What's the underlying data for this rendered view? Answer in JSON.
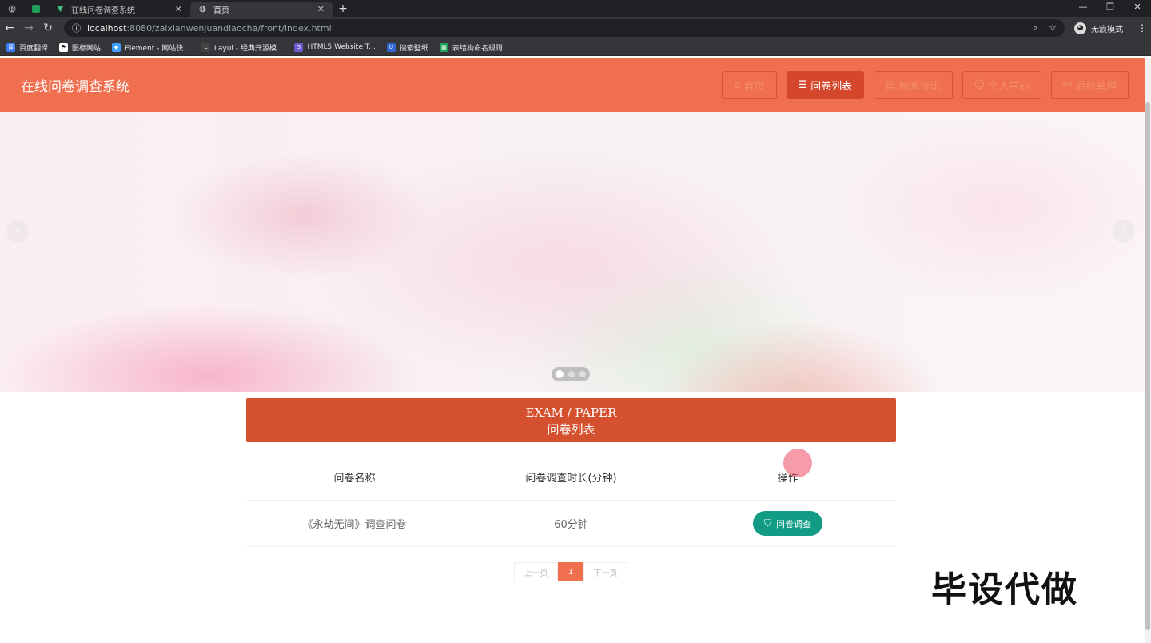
{
  "browser": {
    "tabs": [
      {
        "title": "在线问卷调查系统",
        "active": false
      },
      {
        "title": "首页",
        "active": true
      }
    ],
    "url_host": "localhost",
    "url_path": ":8080/zaixianwenjuandiaocha/front/index.html",
    "incognito_label": "无痕模式",
    "bookmarks": [
      {
        "label": "百度翻译",
        "icon": "translate-icon",
        "color": "#3a7bfd"
      },
      {
        "label": "图标网站",
        "icon": "flag-icon",
        "color": "#222222"
      },
      {
        "label": "Element - 网站快...",
        "icon": "element-icon",
        "color": "#409eff"
      },
      {
        "label": "Layui - 经典开源模...",
        "icon": "layui-icon",
        "color": "#444444"
      },
      {
        "label": "HTML5 Website T...",
        "icon": "html5-icon",
        "color": "#6a5acd"
      },
      {
        "label": "搜索壁纸",
        "icon": "wallpaper-icon",
        "color": "#3367d6"
      },
      {
        "label": "表结构命名规则",
        "icon": "sheet-icon",
        "color": "#1e9e57"
      }
    ]
  },
  "header": {
    "site_title": "在线问卷调查系统",
    "nav": [
      {
        "label": "首页",
        "icon": "home-icon",
        "active": false
      },
      {
        "label": "问卷列表",
        "icon": "list-icon",
        "active": true
      },
      {
        "label": "新闻资讯",
        "icon": "news-icon",
        "active": false
      },
      {
        "label": "个人中心",
        "icon": "user-icon",
        "active": false
      },
      {
        "label": "后台管理",
        "icon": "link-icon",
        "active": false
      }
    ]
  },
  "banner": {
    "prev_icon": "chevron-left-icon",
    "next_icon": "chevron-right-icon",
    "dots": 3,
    "active_dot": 0
  },
  "section": {
    "title_en": "EXAM / PAPER",
    "title_cn": "问卷列表"
  },
  "table": {
    "columns": [
      "问卷名称",
      "问卷调查时长(分钟)",
      "操作"
    ],
    "rows": [
      {
        "name": "《永劫无间》调查问卷",
        "duration": "60分钟",
        "action": "问卷调查"
      }
    ]
  },
  "pagination": {
    "prev": "上一页",
    "current": "1",
    "next": "下一页"
  },
  "watermark": "毕设代做",
  "colors": {
    "header": "#ef6f4e",
    "section_head": "#d4502f",
    "action_button": "#129c86"
  }
}
